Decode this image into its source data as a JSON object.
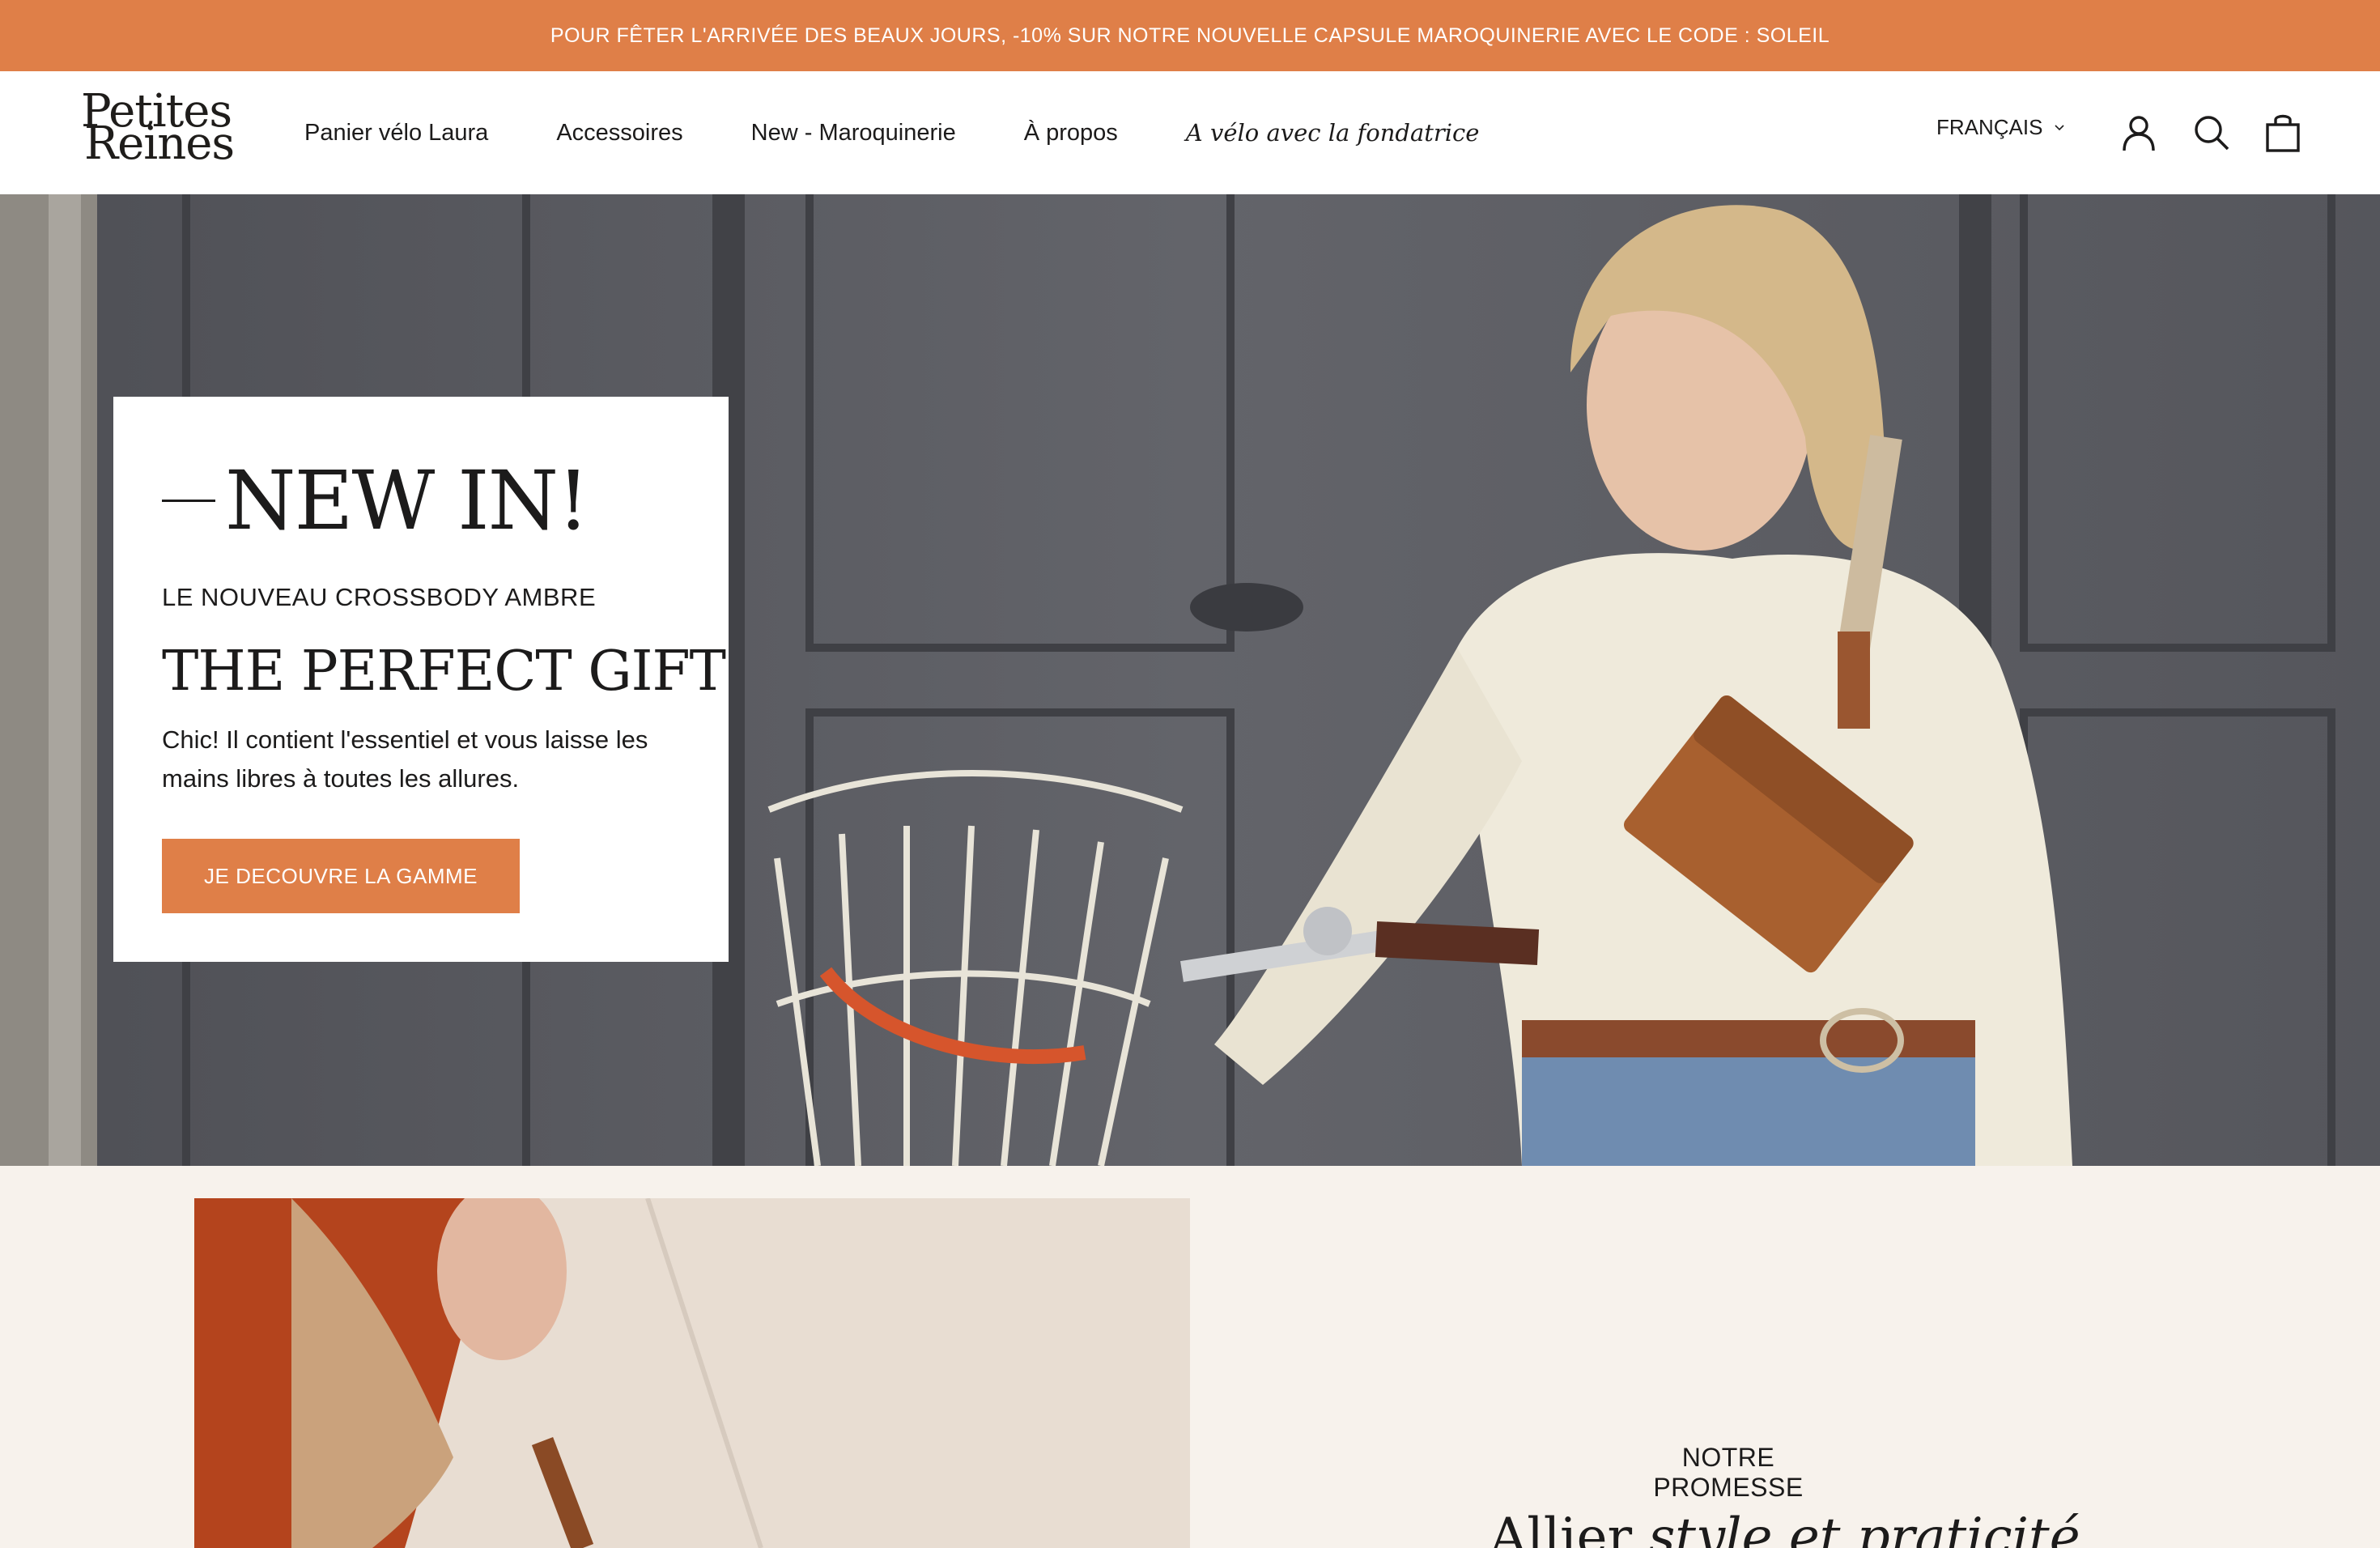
{
  "announcement": "POUR FÊTER L'ARRIVÉE DES BEAUX JOURS, -10% SUR NOTRE NOUVELLE CAPSULE MAROQUINERIE AVEC LE CODE : SOLEIL",
  "brand": {
    "line1": "Petites",
    "line2": "Reines"
  },
  "nav": {
    "items": [
      {
        "label": "Panier vélo Laura"
      },
      {
        "label": "Accessoires"
      },
      {
        "label": "New - Maroquinerie"
      },
      {
        "label": "À propos"
      },
      {
        "label": "A vélo avec la fondatrice"
      }
    ]
  },
  "header": {
    "language": "FRANÇAIS",
    "icons": [
      "account-icon",
      "search-icon",
      "cart-icon"
    ]
  },
  "hero": {
    "title": "NEW IN!",
    "subtitle": "LE NOUVEAU CROSSBODY AMBRE",
    "heading": "THE PERFECT GIFT",
    "description": "Chic! Il contient l'essentiel et vous laisse les mains libres à toutes les allures.",
    "cta": "JE DECOUVRE LA GAMME"
  },
  "promise": {
    "label": "NOTRE PROMESSE",
    "title_plain": "Allier ",
    "title_italic": "style et praticité"
  },
  "colors": {
    "accent": "#df7f48",
    "background": "#f7f2ec",
    "text": "#1c1b1b"
  }
}
